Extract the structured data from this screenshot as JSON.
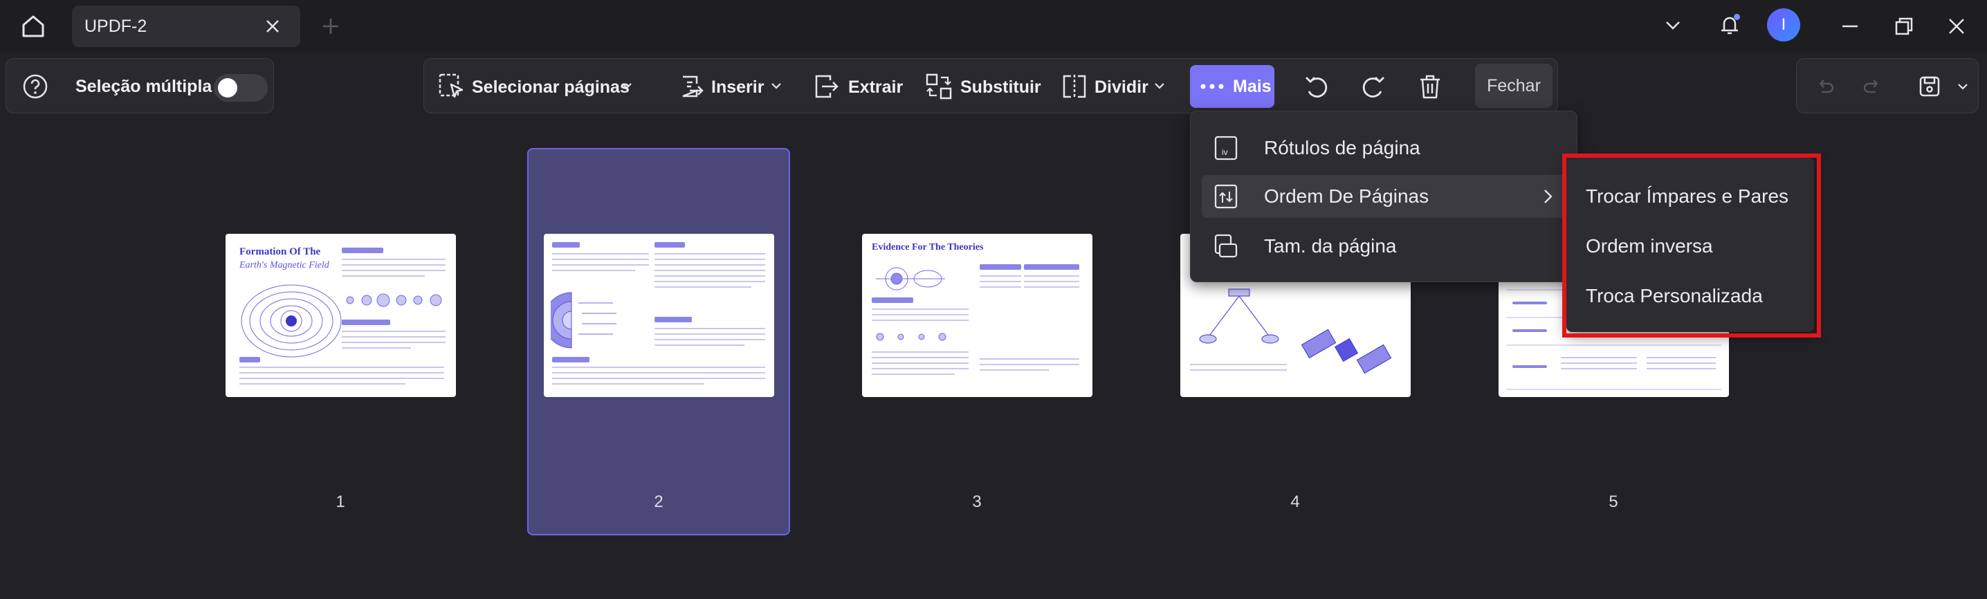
{
  "titlebar": {
    "tab_title": "UPDF-2",
    "avatar_letter": "I"
  },
  "toolbar": {
    "multi_select_label": "Seleção múltipla",
    "multi_select_on": false,
    "select_pages": "Selecionar páginas",
    "insert": "Inserir",
    "extract": "Extrair",
    "replace": "Substituir",
    "split": "Dividir",
    "more": "Mais",
    "close": "Fechar"
  },
  "menu": {
    "items": [
      {
        "label": "Rótulos de página",
        "icon": "page-label-icon"
      },
      {
        "label": "Ordem De Páginas",
        "icon": "page-order-icon",
        "has_submenu": true
      },
      {
        "label": "Tam. da página",
        "icon": "page-size-icon"
      }
    ]
  },
  "submenu": {
    "items": [
      {
        "label": "Trocar Ímpares e Pares"
      },
      {
        "label": "Ordem inversa"
      },
      {
        "label": "Troca Personalizada"
      }
    ]
  },
  "pages": [
    {
      "number": "1",
      "title_line1": "Formation Of The",
      "title_line2": "Earth's Magnetic Field"
    },
    {
      "number": "2",
      "selected": true
    },
    {
      "number": "3",
      "title_line1": "Evidence For The Theories"
    },
    {
      "number": "4"
    },
    {
      "number": "5"
    }
  ],
  "colors": {
    "accent": "#7b73f5",
    "selection_fill": "#4a4878",
    "highlight_box": "#e0161b"
  }
}
